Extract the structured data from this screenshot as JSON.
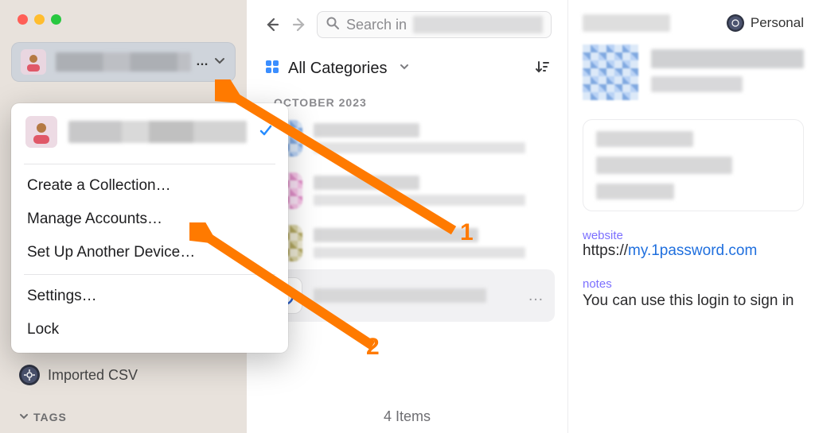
{
  "sidebar": {
    "account_name": "",
    "account_ellipsis": "…",
    "imported_label": "Imported CSV",
    "tags_label": "TAGS"
  },
  "dropdown": {
    "account_name": "",
    "items": {
      "create_collection": "Create a Collection…",
      "manage_accounts": "Manage Accounts…",
      "set_up_device": "Set Up Another Device…",
      "settings": "Settings…",
      "lock": "Lock"
    }
  },
  "search": {
    "prefix": "Search in",
    "value": ""
  },
  "filters": {
    "label": "All Categories"
  },
  "list": {
    "section_date": "OCTOBER 2023",
    "count_label": "4 Items"
  },
  "detail": {
    "vault_label": "Personal",
    "website_label": "website",
    "website_url_prefix": "https://",
    "website_url_host": "my.1password.com",
    "notes_label": "notes",
    "notes_body": "You can use this login to sign in"
  },
  "annotations": {
    "arrow1": "1",
    "arrow2": "2"
  }
}
